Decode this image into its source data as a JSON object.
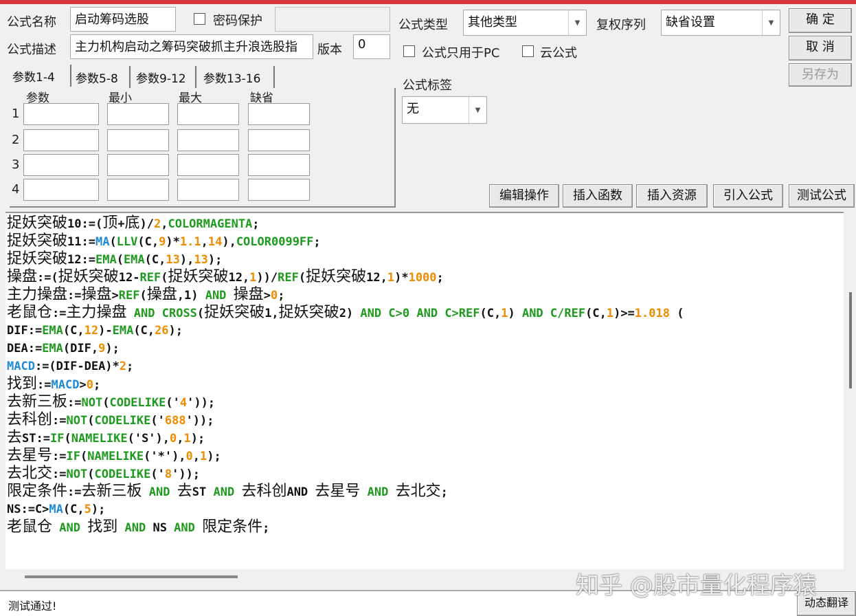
{
  "form": {
    "name_label": "公式名称",
    "name_value": "启动筹码选股",
    "password_label": "密码保护",
    "desc_label": "公式描述",
    "desc_value": "主力机构启动之筹码突破抓主升浪选股指",
    "version_label": "版本",
    "version_value": "0",
    "type_label": "公式类型",
    "type_value": "其他类型",
    "rights_label": "复权序列",
    "rights_value": "缺省设置",
    "pc_only_label": "公式只用于PC",
    "cloud_label": "云公式",
    "tag_label": "公式标签",
    "tag_value": "无"
  },
  "buttons": {
    "ok": "确  定",
    "cancel": "取  消",
    "save_as": "另存为",
    "edit_ops": "编辑操作",
    "insert_func": "插入函数",
    "insert_res": "插入资源",
    "import_formula": "引入公式",
    "test_formula": "测试公式",
    "dyn_translate": "动态翻译"
  },
  "tabs": [
    "参数1-4",
    "参数5-8",
    "参数9-12",
    "参数13-16"
  ],
  "params": {
    "headers": [
      "参数",
      "最小",
      "最大",
      "缺省"
    ],
    "rows": [
      "1",
      "2",
      "3",
      "4"
    ]
  },
  "editor": {
    "lines": [
      [
        [
          "捉妖突破",
          "c"
        ],
        [
          "10:=(",
          "t"
        ],
        [
          "顶",
          "c"
        ],
        [
          "+",
          "t"
        ],
        [
          "底",
          "c"
        ],
        [
          ")/",
          "t"
        ],
        [
          "2",
          "n"
        ],
        [
          ",",
          "t"
        ],
        [
          "COLORMAGENTA",
          "f"
        ],
        [
          ";",
          "t"
        ]
      ],
      [
        [
          "捉妖突破",
          "c"
        ],
        [
          "11:=",
          "t"
        ],
        [
          "MA",
          "b"
        ],
        [
          "(",
          "t"
        ],
        [
          "LLV",
          "f"
        ],
        [
          "(C,",
          "t"
        ],
        [
          "9",
          "n"
        ],
        [
          ")*",
          "t"
        ],
        [
          "1.1",
          "n"
        ],
        [
          ",",
          "t"
        ],
        [
          "14",
          "n"
        ],
        [
          "),",
          "t"
        ],
        [
          "COLOR0099FF",
          "f"
        ],
        [
          ";",
          "t"
        ]
      ],
      [
        [
          "捉妖突破",
          "c"
        ],
        [
          "12:=",
          "t"
        ],
        [
          "EMA",
          "f"
        ],
        [
          "(",
          "t"
        ],
        [
          "EMA",
          "f"
        ],
        [
          "(C,",
          "t"
        ],
        [
          "13",
          "n"
        ],
        [
          "),",
          "t"
        ],
        [
          "13",
          "n"
        ],
        [
          ");",
          "t"
        ]
      ],
      [
        [
          "操盘",
          "c"
        ],
        [
          ":=(",
          "t"
        ],
        [
          "捉妖突破",
          "c"
        ],
        [
          "12-",
          "t"
        ],
        [
          "REF",
          "f"
        ],
        [
          "(",
          "t"
        ],
        [
          "捉妖突破",
          "c"
        ],
        [
          "12,",
          "t"
        ],
        [
          "1",
          "n"
        ],
        [
          "))/",
          "t"
        ],
        [
          "REF",
          "f"
        ],
        [
          "(",
          "t"
        ],
        [
          "捉妖突破",
          "c"
        ],
        [
          "12,",
          "t"
        ],
        [
          "1",
          "n"
        ],
        [
          ")*",
          "t"
        ],
        [
          "1000",
          "n"
        ],
        [
          ";",
          "t"
        ]
      ],
      [
        [
          "主力操盘",
          "c"
        ],
        [
          ":=",
          "t"
        ],
        [
          "操盘",
          "c"
        ],
        [
          ">",
          "t"
        ],
        [
          "REF",
          "f"
        ],
        [
          "(",
          "t"
        ],
        [
          "操盘",
          "c"
        ],
        [
          ",1) ",
          "t"
        ],
        [
          "AND",
          "f"
        ],
        [
          " ",
          "t"
        ],
        [
          "操盘",
          "c"
        ],
        [
          ">",
          "t"
        ],
        [
          "0",
          "n"
        ],
        [
          ";",
          "t"
        ]
      ],
      [
        [
          "老鼠仓",
          "c"
        ],
        [
          ":=",
          "t"
        ],
        [
          "主力操盘",
          "c"
        ],
        [
          " ",
          "t"
        ],
        [
          "AND",
          "f"
        ],
        [
          " ",
          "t"
        ],
        [
          "CROSS",
          "f"
        ],
        [
          "(",
          "t"
        ],
        [
          "捉妖突破",
          "c"
        ],
        [
          "1,",
          "t"
        ],
        [
          "捉妖突破",
          "c"
        ],
        [
          "2) ",
          "t"
        ],
        [
          "AND",
          "f"
        ],
        [
          " ",
          "t"
        ],
        [
          "C>0",
          "f"
        ],
        [
          " ",
          "t"
        ],
        [
          "AND",
          "f"
        ],
        [
          " ",
          "t"
        ],
        [
          "C>REF",
          "f"
        ],
        [
          "(C,",
          "t"
        ],
        [
          "1",
          "n"
        ],
        [
          ") ",
          "t"
        ],
        [
          "AND",
          "f"
        ],
        [
          " ",
          "t"
        ],
        [
          "C/REF",
          "f"
        ],
        [
          "(C,",
          "t"
        ],
        [
          "1",
          "n"
        ],
        [
          ")>=",
          "t"
        ],
        [
          "1.018",
          "n"
        ],
        [
          " (",
          "t"
        ]
      ],
      [
        [
          "DIF:=",
          "t"
        ],
        [
          "EMA",
          "f"
        ],
        [
          "(C,",
          "t"
        ],
        [
          "12",
          "n"
        ],
        [
          ")-",
          "t"
        ],
        [
          "EMA",
          "f"
        ],
        [
          "(C,",
          "t"
        ],
        [
          "26",
          "n"
        ],
        [
          ");",
          "t"
        ]
      ],
      [
        [
          "DEA:=",
          "t"
        ],
        [
          "EMA",
          "f"
        ],
        [
          "(DIF,",
          "t"
        ],
        [
          "9",
          "n"
        ],
        [
          ");",
          "t"
        ]
      ],
      [
        [
          "MACD",
          "b"
        ],
        [
          ":=(DIF-DEA)*",
          "t"
        ],
        [
          "2",
          "n"
        ],
        [
          ";",
          "t"
        ]
      ],
      [
        [
          "找到",
          "c"
        ],
        [
          ":=",
          "t"
        ],
        [
          "MACD",
          "b"
        ],
        [
          ">",
          "t"
        ],
        [
          "0",
          "n"
        ],
        [
          ";",
          "t"
        ]
      ],
      [
        [
          "去新三板",
          "c"
        ],
        [
          ":=",
          "t"
        ],
        [
          "NOT",
          "f"
        ],
        [
          "(",
          "t"
        ],
        [
          "CODELIKE",
          "f"
        ],
        [
          "('",
          "t"
        ],
        [
          "4",
          "n"
        ],
        [
          "'));",
          "t"
        ]
      ],
      [
        [
          "去科创",
          "c"
        ],
        [
          ":=",
          "t"
        ],
        [
          "NOT",
          "f"
        ],
        [
          "(",
          "t"
        ],
        [
          "CODELIKE",
          "f"
        ],
        [
          "('",
          "t"
        ],
        [
          "688",
          "n"
        ],
        [
          "'));",
          "t"
        ]
      ],
      [
        [
          "去",
          "c"
        ],
        [
          "ST:=",
          "t"
        ],
        [
          "IF",
          "f"
        ],
        [
          "(",
          "t"
        ],
        [
          "NAMELIKE",
          "f"
        ],
        [
          "('S'),",
          "t"
        ],
        [
          "0",
          "n"
        ],
        [
          ",",
          "t"
        ],
        [
          "1",
          "n"
        ],
        [
          ");",
          "t"
        ]
      ],
      [
        [
          "去星号",
          "c"
        ],
        [
          ":=",
          "t"
        ],
        [
          "IF",
          "f"
        ],
        [
          "(",
          "t"
        ],
        [
          "NAMELIKE",
          "f"
        ],
        [
          "('*'),",
          "t"
        ],
        [
          "0",
          "n"
        ],
        [
          ",",
          "t"
        ],
        [
          "1",
          "n"
        ],
        [
          ");",
          "t"
        ]
      ],
      [
        [
          "去北交",
          "c"
        ],
        [
          ":=",
          "t"
        ],
        [
          "NOT",
          "f"
        ],
        [
          "(",
          "t"
        ],
        [
          "CODELIKE",
          "f"
        ],
        [
          "('",
          "t"
        ],
        [
          "8",
          "n"
        ],
        [
          "'));",
          "t"
        ]
      ],
      [
        [
          "限定条件",
          "c"
        ],
        [
          ":=",
          "t"
        ],
        [
          "去新三板",
          "c"
        ],
        [
          " ",
          "t"
        ],
        [
          "AND",
          "f"
        ],
        [
          " ",
          "t"
        ],
        [
          "去",
          "c"
        ],
        [
          "ST ",
          "t"
        ],
        [
          "AND",
          "f"
        ],
        [
          " ",
          "t"
        ],
        [
          "去科创",
          "c"
        ],
        [
          "AND ",
          "t"
        ],
        [
          "去星号",
          "c"
        ],
        [
          " ",
          "t"
        ],
        [
          "AND",
          "f"
        ],
        [
          " ",
          "t"
        ],
        [
          "去北交",
          "c"
        ],
        [
          ";",
          "t"
        ]
      ],
      [
        [
          "NS:=C>",
          "t"
        ],
        [
          "MA",
          "b"
        ],
        [
          "(C,",
          "t"
        ],
        [
          "5",
          "n"
        ],
        [
          ");",
          "t"
        ]
      ],
      [
        [
          "老鼠仓",
          "c"
        ],
        [
          " ",
          "t"
        ],
        [
          "AND",
          "f"
        ],
        [
          " ",
          "t"
        ],
        [
          "找到",
          "c"
        ],
        [
          " ",
          "t"
        ],
        [
          "AND",
          "f"
        ],
        [
          " NS ",
          "t"
        ],
        [
          "AND",
          "f"
        ],
        [
          " ",
          "t"
        ],
        [
          "限定条件",
          "c"
        ],
        [
          ";",
          "t"
        ]
      ]
    ]
  },
  "status": {
    "message": "测试通过!"
  },
  "watermark": "知乎 @股市量化程序猿",
  "colors": {
    "function": "#1e9a1e",
    "builtin": "#1f8ad6",
    "number": "#f08c00",
    "title_bar": "#d9333a"
  }
}
